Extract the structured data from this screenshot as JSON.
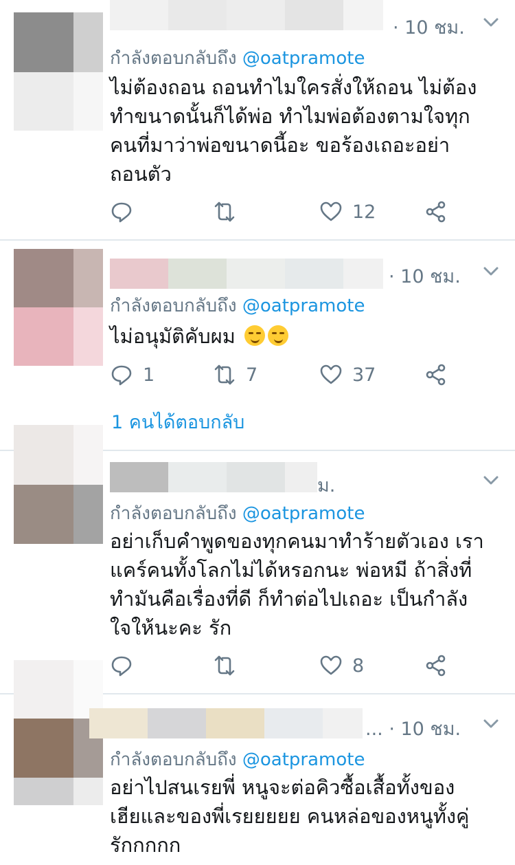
{
  "tweets": [
    {
      "time": "· 10 ชม.",
      "replying_prefix": "กำลังตอบกลับถึง",
      "replying_handle": "@oatpramote",
      "lines": [
        "ไม่ต้องถอน ถอนทำไมใครสั่งให้ถอน  ไม่ต้อง",
        "ทำขนาดนั้นก็ได้พ่อ ทำไมพ่อต้องตามใจทุก",
        "คนที่มาว่าพ่อขนาดนี้อะ ขอร้องเถอะอย่า",
        "ถอนตัว"
      ],
      "reply_count": "",
      "retweet_count": "",
      "like_count": "12"
    },
    {
      "time": "· 10 ชม.",
      "replying_prefix": "กำลังตอบกลับถึง",
      "replying_handle": "@oatpramote",
      "lines": [
        "ไม่อนุมัติคับผม"
      ],
      "reply_count": "1",
      "retweet_count": "7",
      "like_count": "37",
      "more_replies": "1 คนได้ตอบกลับ"
    },
    {
      "time": "ม.",
      "replying_prefix": "กำลังตอบกลับถึง",
      "replying_handle": "@oatpramote",
      "lines": [
        "อย่าเก็บคำพูดของทุกคนมาทำร้ายตัวเอง เรา",
        "แคร์คนทั้งโลกไม่ได้หรอกนะ พ่อหมี ถ้าสิ่งที่",
        "ทำมันคือเรื่องที่ดี ก็ทำต่อไปเถอะ เป็นกำลัง",
        "ใจให้นะคะ รัก"
      ],
      "reply_count": "",
      "retweet_count": "",
      "like_count": "8"
    },
    {
      "time": "... · 10 ชม.",
      "replying_prefix": "กำลังตอบกลับถึง",
      "replying_handle": "@oatpramote",
      "lines": [
        "อย่าไปสนเรยพี่ หนูจะต่อคิวซื้อเสื้อทั้งของ",
        "เฮียและของพี่เรยยยยย คนหล่อของหนูทั้งคู่",
        "รักกกกก"
      ],
      "reply_count": "",
      "retweet_count": "",
      "like_count": ""
    }
  ],
  "icons": {
    "reply": "reply-icon",
    "retweet": "retweet-icon",
    "like": "heart-icon",
    "share": "share-icon",
    "chevron": "chevron-down-icon"
  },
  "colors": {
    "link_blue": "#1b95e0",
    "meta_gray": "#657786",
    "divider": "#e1e8ed"
  }
}
